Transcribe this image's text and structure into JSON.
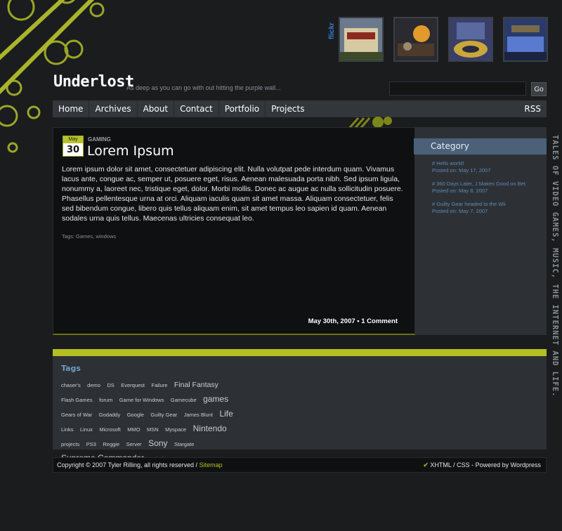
{
  "site": {
    "logo": "Underlost",
    "tagline": "As deep as you can go with out hitting the purple wall...",
    "flickr_label": "flickr",
    "vertical_text": "TALES OF VIDEO GAMES, MUSIC, THE INTERNET AND LIFE."
  },
  "search": {
    "placeholder": "",
    "button": "Go"
  },
  "nav": {
    "items": [
      "Home",
      "Archives",
      "About",
      "Contact",
      "Portfolio",
      "Projects"
    ],
    "rss": "RSS"
  },
  "post": {
    "month": "May",
    "day": "30",
    "category": "GAMING",
    "title": "Lorem Ipsum",
    "body": "Lorem ipsum dolor sit amet, consectetuer adipiscing elit. Nulla volutpat pede interdum quam. Vivamus lacus ante, congue ac, semper ut, posuere eget, risus. Aenean malesuada porta nibh. Sed ipsum ligula, nonummy a, laoreet nec, tristique eget, dolor. Morbi mollis. Donec ac augue ac nulla sollicitudin posuere. Phasellus pellentesque urna at orci. Aliquam iaculis quam sit amet massa. Aliquam consectetuer, felis sed bibendum congue, libero quis tellus aliquam enim, sit amet tempus leo sapien id quam. Aenean sodales urna quis tellus. Maecenas ultricies consequat leo.",
    "tags": "Tags: Games, windows",
    "footer": "May 30th, 2007 • 1 Comment"
  },
  "sidebar": {
    "heading": "Category",
    "items": [
      {
        "link": "# Hello world!",
        "date": "Posted on: May 17, 2007"
      },
      {
        "link": "# 360 Days Later, J Makes Good on Bet",
        "date": "Posted on: May 8, 2007"
      },
      {
        "link": "# Guilty Gear headed to the Wii",
        "date": "Posted on: May 7, 2007"
      }
    ]
  },
  "tags": {
    "heading": "Tags",
    "cloud": [
      {
        "t": "chaser's",
        "s": 1
      },
      {
        "t": "demo",
        "s": 1
      },
      {
        "t": "DS",
        "s": 1
      },
      {
        "t": "Everquest",
        "s": 1
      },
      {
        "t": "Failure",
        "s": 1
      },
      {
        "t": "Final Fantasy",
        "s": 3
      },
      {
        "t": "Flash Games",
        "s": 1
      },
      {
        "t": "forum",
        "s": 1
      },
      {
        "t": "Game for Windows",
        "s": 1
      },
      {
        "t": "Gamecube",
        "s": 1
      },
      {
        "t": "games",
        "s": 4
      },
      {
        "t": "Gears of War",
        "s": 1
      },
      {
        "t": "Godaddy",
        "s": 1
      },
      {
        "t": "Google",
        "s": 1
      },
      {
        "t": "Guilty Gear",
        "s": 1
      },
      {
        "t": "James Blunt",
        "s": 1
      },
      {
        "t": "Life",
        "s": 4
      },
      {
        "t": "Links",
        "s": 1
      },
      {
        "t": "Linux",
        "s": 1
      },
      {
        "t": "Microsoft",
        "s": 1
      },
      {
        "t": "MMO",
        "s": 1
      },
      {
        "t": "MSN",
        "s": 1
      },
      {
        "t": "Myspace",
        "s": 1
      },
      {
        "t": "Nintendo",
        "s": 4
      },
      {
        "t": "projects",
        "s": 1
      },
      {
        "t": "PS3",
        "s": 1
      },
      {
        "t": "Reggie",
        "s": 1
      },
      {
        "t": "Server",
        "s": 1
      },
      {
        "t": "Sony",
        "s": 4
      },
      {
        "t": "Stargate",
        "s": 1
      },
      {
        "t": "Supreme Commander",
        "s": 4
      },
      {
        "t": "Tabula",
        "s": 1
      }
    ]
  },
  "footer": {
    "copyright": "Copyright © 2007 Tyler Rilling, all rights reserved / ",
    "sitemap": "Sitemap",
    "xhtml": "XHTML",
    "sep": " / ",
    "css": "CSS",
    "powered": " - Powered by Wordpress"
  },
  "colors": {
    "accent": "#b4c022",
    "nav_bg": "#33373c",
    "category_head": "#4a6178",
    "link": "#5f89b0"
  }
}
